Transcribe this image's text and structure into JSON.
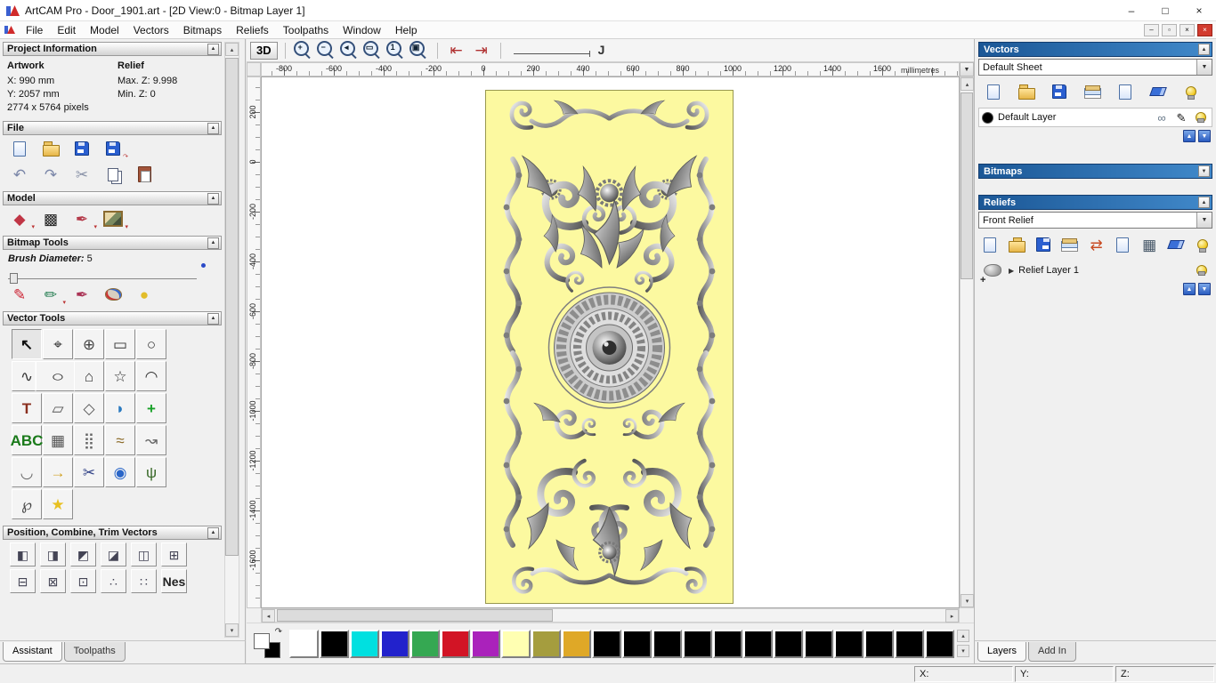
{
  "window": {
    "title": "ArtCAM Pro - Door_1901.art - [2D View:0 - Bitmap Layer 1]",
    "minimize": "–",
    "maximize": "□",
    "close": "×"
  },
  "menu": {
    "items": [
      {
        "name": "menu-file",
        "label": "File"
      },
      {
        "name": "menu-edit",
        "label": "Edit"
      },
      {
        "name": "menu-model",
        "label": "Model"
      },
      {
        "name": "menu-vectors",
        "label": "Vectors"
      },
      {
        "name": "menu-bitmaps",
        "label": "Bitmaps"
      },
      {
        "name": "menu-reliefs",
        "label": "Reliefs"
      },
      {
        "name": "menu-toolpaths",
        "label": "Toolpaths"
      },
      {
        "name": "menu-window",
        "label": "Window"
      },
      {
        "name": "menu-help",
        "label": "Help"
      }
    ],
    "mdi": [
      "–",
      "▫",
      "×"
    ]
  },
  "assistant": {
    "project_information": {
      "title": "Project Information",
      "artwork_heading": "Artwork",
      "relief_heading": "Relief",
      "artwork_x": "X: 990 mm",
      "artwork_y": "Y: 2057 mm",
      "artwork_pixels": "2774 x 5764 pixels",
      "relief_max_z": "Max. Z: 9.998",
      "relief_min_z": "Min. Z: 0"
    },
    "file": {
      "title": "File",
      "icons_row1": [
        {
          "name": "new-model",
          "type": "page"
        },
        {
          "name": "open-model",
          "type": "folder"
        },
        {
          "name": "save-model",
          "type": "floppy"
        },
        {
          "name": "save-model-as",
          "type": "floppy",
          "badge": "↷"
        }
      ],
      "icons_row2": [
        {
          "name": "undo",
          "type": "glyph",
          "glyph": "↶",
          "color": "#7a86a8"
        },
        {
          "name": "redo",
          "type": "glyph",
          "glyph": "↷",
          "color": "#7a86a8"
        },
        {
          "name": "cut",
          "type": "glyph",
          "glyph": "✂",
          "color": "#8a93a8"
        },
        {
          "name": "copy",
          "type": "copy"
        },
        {
          "name": "paste",
          "type": "clipboard"
        }
      ]
    },
    "model": {
      "title": "Model",
      "icons": [
        {
          "name": "set-model-size",
          "type": "glyph",
          "glyph": "◆",
          "color": "#c03545",
          "badge": "▾"
        },
        {
          "name": "adjust-model",
          "type": "glyph",
          "glyph": "▩",
          "color": "#222222"
        },
        {
          "name": "edit-relief",
          "type": "glyph",
          "glyph": "✒",
          "color": "#b43a4a",
          "badge": "▾"
        },
        {
          "name": "load-bitmap-image",
          "type": "pic",
          "badge": "▾"
        }
      ]
    },
    "bitmap_tools": {
      "title": "Bitmap Tools",
      "brush_label": "Brush Diameter:",
      "brush_value": "5",
      "icons": [
        {
          "name": "paint-tool",
          "type": "glyph",
          "glyph": "✎",
          "color": "#cc2233"
        },
        {
          "name": "paint-selective-tool",
          "type": "glyph",
          "glyph": "✏",
          "color": "#1f7a4d",
          "badge": "▾"
        },
        {
          "name": "draw-tool",
          "type": "glyph",
          "glyph": "✒",
          "color": "#aa3355"
        },
        {
          "name": "colour-palette-tool",
          "type": "palette"
        },
        {
          "name": "flood-fill-tool",
          "type": "glyph",
          "glyph": "●",
          "color": "#e2bd2a"
        }
      ]
    },
    "vector_tools": {
      "title": "Vector Tools",
      "tools": [
        {
          "name": "select-vectors",
          "type": "glyph",
          "glyph": "↖",
          "color": "#111111",
          "bold": true
        },
        {
          "name": "node-editing",
          "type": "glyph",
          "glyph": "⌖",
          "color": "#333333"
        },
        {
          "name": "transform-vectors",
          "type": "glyph",
          "glyph": "⊕",
          "color": "#444444"
        },
        {
          "name": "create-rectangle",
          "type": "glyph",
          "glyph": "▭",
          "color": "#333333"
        },
        {
          "name": "create-circle",
          "type": "glyph",
          "glyph": "○",
          "color": "#333333"
        },
        {
          "name": "create-polyline",
          "type": "glyph",
          "glyph": "∿",
          "color": "#333333"
        },
        {
          "name": "create-ellipse",
          "type": "glyph",
          "glyph": "○",
          "color": "#333333",
          "wide": true
        },
        {
          "name": "create-polygon",
          "type": "glyph",
          "glyph": "⌂",
          "color": "#333333"
        },
        {
          "name": "create-star",
          "type": "glyph",
          "glyph": "☆",
          "color": "#333333"
        },
        {
          "name": "create-arc",
          "type": "glyph",
          "glyph": "◠",
          "color": "#333333"
        },
        {
          "name": "create-vector-text",
          "type": "glyph",
          "glyph": "T",
          "color": "#8a2f1f",
          "bold": true
        },
        {
          "name": "wrap-text",
          "type": "glyph",
          "glyph": "▱",
          "color": "#555555"
        },
        {
          "name": "offset-vectors",
          "type": "glyph",
          "glyph": "◇",
          "color": "#555555"
        },
        {
          "name": "fillet-vectors",
          "type": "glyph",
          "glyph": "◗",
          "color": "#2a7ac0"
        },
        {
          "name": "paste-vector",
          "type": "glyph",
          "glyph": "+",
          "color": "#18a028",
          "bold": true
        },
        {
          "name": "convert-text-to-vectors",
          "type": "abc",
          "label": "ABC"
        },
        {
          "name": "make-grid",
          "type": "glyph",
          "glyph": "▦",
          "color": "#555555"
        },
        {
          "name": "block-array-copy",
          "type": "glyph",
          "glyph": "⣿",
          "color": "#666666"
        },
        {
          "name": "paste-along-curve",
          "type": "glyph",
          "glyph": "≈",
          "color": "#886622"
        },
        {
          "name": "smooth-vectors",
          "type": "glyph",
          "glyph": "↝",
          "color": "#666666"
        },
        {
          "name": "fit-arcs-to-polyline",
          "type": "glyph",
          "glyph": "◡",
          "color": "#666666"
        },
        {
          "name": "join-vectors",
          "type": "glyph",
          "glyph": "→",
          "color": "#d0a020",
          "bold": true
        },
        {
          "name": "trim-vectors",
          "type": "glyph",
          "glyph": "✂",
          "color": "#334488"
        },
        {
          "name": "vector-doctor",
          "type": "glyph",
          "glyph": "◉",
          "color": "#2a66c8"
        },
        {
          "name": "texture-flow",
          "type": "glyph",
          "glyph": "ψ",
          "color": "#3a6a2a"
        },
        {
          "name": "create-boundary",
          "type": "glyph",
          "glyph": "℘",
          "color": "#444444"
        },
        {
          "name": "bitmap-to-vector",
          "type": "glyph",
          "glyph": "★",
          "color": "#e8c020"
        }
      ]
    },
    "position_tools": {
      "title": "Position, Combine, Trim Vectors",
      "row1": [
        {
          "name": "align-left",
          "type": "glyph",
          "glyph": "◧",
          "color": "#444455"
        },
        {
          "name": "align-right",
          "type": "glyph",
          "glyph": "◨",
          "color": "#444455"
        },
        {
          "name": "align-top",
          "type": "glyph",
          "glyph": "◩",
          "color": "#444455"
        },
        {
          "name": "align-bottom",
          "type": "glyph",
          "glyph": "◪",
          "color": "#444455"
        },
        {
          "name": "align-centre",
          "type": "glyph",
          "glyph": "◫",
          "color": "#444455"
        },
        {
          "name": "centre-in-page",
          "type": "glyph",
          "glyph": "⊞",
          "color": "#444455"
        }
      ],
      "row2": [
        {
          "name": "weld-vectors",
          "type": "glyph",
          "glyph": "⊟",
          "color": "#444455"
        },
        {
          "name": "subtract-vectors",
          "type": "glyph",
          "glyph": "⊠",
          "color": "#444455"
        },
        {
          "name": "trim-overlap",
          "type": "glyph",
          "glyph": "⊡",
          "color": "#444455"
        },
        {
          "name": "array-copy",
          "type": "glyph",
          "glyph": "∴",
          "color": "#444455"
        },
        {
          "name": "scatter-copy",
          "type": "glyph",
          "glyph": "∷",
          "color": "#444455"
        },
        {
          "name": "nesting",
          "type": "text",
          "label": "Nes",
          "color": "#222222"
        }
      ]
    },
    "tabs": [
      {
        "label": "Assistant",
        "active": true
      },
      {
        "label": "Toolpaths",
        "active": false
      }
    ]
  },
  "view": {
    "toolbar": {
      "view3d_label": "3D",
      "zoom_tools": [
        {
          "name": "zoom-in",
          "type": "zoom",
          "sym": "+"
        },
        {
          "name": "zoom-out",
          "type": "zoom",
          "sym": "−"
        },
        {
          "name": "zoom-previous",
          "type": "zoom",
          "sym": "◂"
        },
        {
          "name": "zoom-window",
          "type": "zoom",
          "sym": "▭"
        },
        {
          "name": "zoom-1-to-1",
          "type": "zoom",
          "sym": "1"
        },
        {
          "name": "zoom-fit-page",
          "type": "zoom",
          "sym": "▣"
        }
      ],
      "nav_tools": [
        {
          "name": "previous-view",
          "type": "glyph",
          "glyph": "⇤",
          "color": "#b03030"
        },
        {
          "name": "next-view",
          "type": "glyph",
          "glyph": "⇥",
          "color": "#b03030"
        }
      ],
      "curve_glyph": "J"
    },
    "ruler": {
      "h_labels": [
        "-800",
        "-600",
        "-400",
        "-200",
        "0",
        "200",
        "400",
        "600",
        "800",
        "1000",
        "1200",
        "1400",
        "1600"
      ],
      "v_labels": [
        "200",
        "0",
        "-200",
        "-400",
        "-600",
        "-800",
        "-1000",
        "-1200",
        "-1400",
        "-1600"
      ],
      "units": "millimetres"
    }
  },
  "layers_panel": {
    "vectors": {
      "title": "Vectors",
      "sheet_combo": "Default Sheet",
      "icons": [
        {
          "name": "new-vector-layer",
          "type": "page"
        },
        {
          "name": "open-vector-layers",
          "type": "folder"
        },
        {
          "name": "save-vector-layers",
          "type": "floppy"
        },
        {
          "name": "merge-visible-vector-layers",
          "type": "stack"
        },
        {
          "name": "new-vector-sheet",
          "type": "page"
        },
        {
          "name": "delete-vector-layer",
          "type": "eraser"
        },
        {
          "name": "toggle-all-vector-layers",
          "type": "bulb"
        }
      ],
      "layer": {
        "name": "Default Layer",
        "swatch": "#000000"
      },
      "layer_tools": [
        {
          "name": "layer-snap-icon",
          "type": "glyph",
          "glyph": "∞",
          "color": "#667788"
        },
        {
          "name": "layer-colour-icon",
          "type": "glyph",
          "glyph": "✎",
          "color": "#111111"
        },
        {
          "name": "layer-visibility-icon",
          "type": "bulb"
        }
      ],
      "updown": [
        {
          "name": "move-vector-layer-up",
          "type": "navbtn",
          "glyph": "▲"
        },
        {
          "name": "move-vector-layer-down",
          "type": "navbtn",
          "glyph": "▼"
        }
      ]
    },
    "bitmaps": {
      "title": "Bitmaps"
    },
    "reliefs": {
      "title": "Reliefs",
      "relief_combo": "Front Relief",
      "icons": [
        {
          "name": "new-relief-layer",
          "type": "page"
        },
        {
          "name": "open-relief-layer",
          "type": "folder"
        },
        {
          "name": "save-relief-layer",
          "type": "floppy"
        },
        {
          "name": "merge-relief-layers",
          "type": "stack"
        },
        {
          "name": "transfer-relief-layer",
          "type": "glyph",
          "glyph": "⇄",
          "color": "#c84a22"
        },
        {
          "name": "duplicate-relief-layer",
          "type": "page"
        },
        {
          "name": "relief-greyscale-preview",
          "type": "glyph",
          "glyph": "▦",
          "color": "#445566"
        },
        {
          "name": "delete-relief-layer",
          "type": "eraser"
        },
        {
          "name": "toggle-relief-visibility",
          "type": "bulb"
        }
      ],
      "layer": {
        "name": "Relief Layer 1"
      },
      "layer_tools": [
        {
          "name": "relief-visibility-icon",
          "type": "bulb"
        }
      ],
      "updown": [
        {
          "name": "move-relief-layer-up",
          "type": "navbtn",
          "glyph": "▲"
        },
        {
          "name": "move-relief-layer-down",
          "type": "navbtn",
          "glyph": "▼"
        }
      ]
    },
    "tabs": [
      {
        "label": "Layers",
        "active": true
      },
      {
        "label": "Add In",
        "active": false
      }
    ]
  },
  "palette": {
    "fg_color": "#ffffff",
    "bg_color": "#000000",
    "colors": [
      "#ffffff",
      "#000000",
      "#00e0e0",
      "#2222cc",
      "#35a852",
      "#d21425",
      "#aa22bb",
      "#ffffb2",
      "#a59d3e",
      "#dfa827",
      "#000000",
      "#000000",
      "#000000",
      "#000000",
      "#000000",
      "#000000",
      "#000000",
      "#000000",
      "#000000",
      "#000000",
      "#000000",
      "#000000"
    ]
  },
  "status_bar": {
    "x_label": "X:",
    "y_label": "Y:",
    "z_label": "Z:"
  }
}
